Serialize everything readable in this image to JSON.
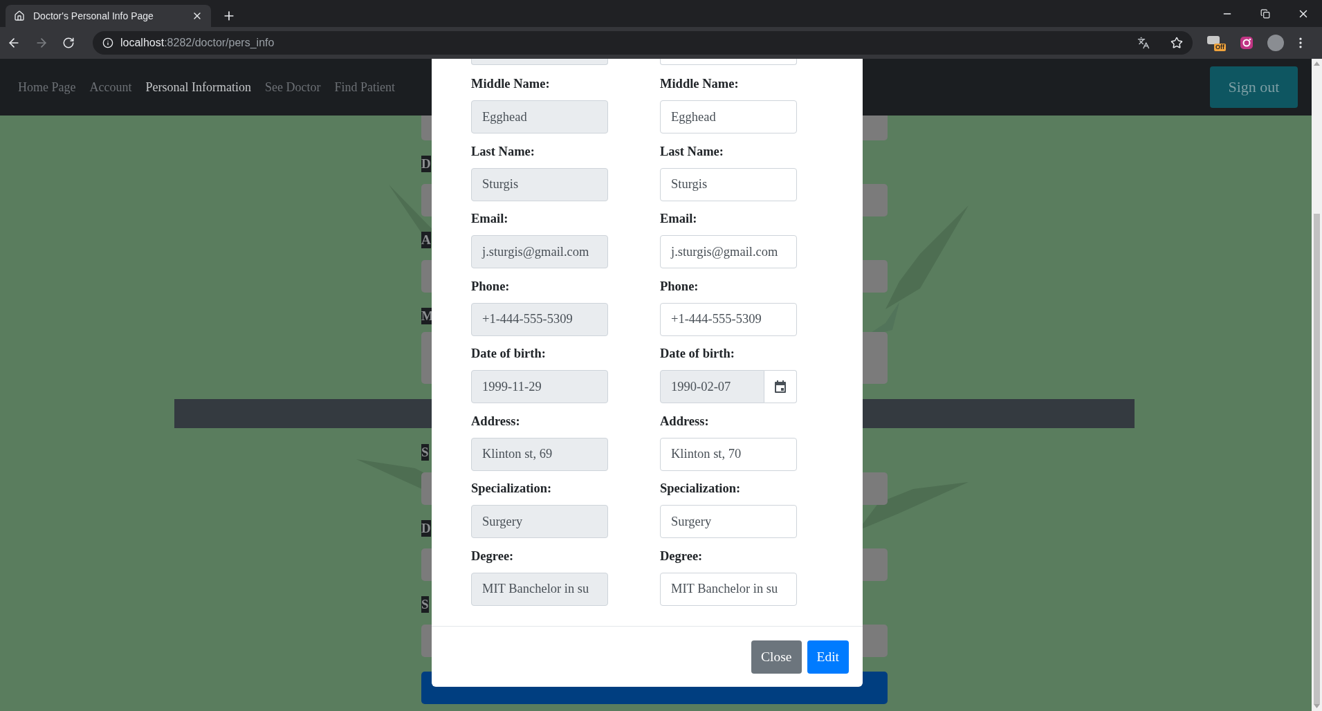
{
  "browser": {
    "tab": {
      "title": "Doctor's Personal Info Page"
    },
    "url": {
      "host": "localhost",
      "path": ":8282/doctor/pers_info"
    },
    "extension_badge": "Off"
  },
  "navbar": {
    "links": [
      {
        "label": "Home Page",
        "selected": false
      },
      {
        "label": "Account",
        "selected": false
      },
      {
        "label": "Personal Information",
        "selected": true
      },
      {
        "label": "See Doctor",
        "selected": false
      },
      {
        "label": "Find Patient",
        "selected": false
      }
    ],
    "sign_out": "Sign out"
  },
  "background_form": {
    "sections": [
      {
        "fields": [
          {
            "kind": "cut"
          },
          {
            "kind": "input",
            "label": "D"
          },
          {
            "kind": "input",
            "label": "A"
          },
          {
            "kind": "textarea",
            "label": "M"
          }
        ]
      },
      {
        "fields": [
          {
            "kind": "input",
            "label": "S"
          },
          {
            "kind": "input",
            "label": "D"
          },
          {
            "kind": "input",
            "label": "S"
          }
        ]
      }
    ]
  },
  "modal": {
    "columns": [
      {
        "fields": [
          {
            "kind": "cut",
            "disabled": true
          },
          {
            "kind": "text",
            "label": "Middle Name:",
            "value": "Egghead",
            "disabled": true
          },
          {
            "kind": "text",
            "label": "Last Name:",
            "value": "Sturgis",
            "disabled": true
          },
          {
            "kind": "text",
            "label": "Email:",
            "value": "j.sturgis@gmail.com",
            "disabled": true
          },
          {
            "kind": "text",
            "label": "Phone:",
            "value": "+1-444-555-5309",
            "disabled": true
          },
          {
            "kind": "text",
            "label": "Date of birth:",
            "value": "1999-11-29",
            "disabled": true
          },
          {
            "kind": "text",
            "label": "Address:",
            "value": "Klinton st, 69",
            "disabled": true
          },
          {
            "kind": "text",
            "label": "Specialization:",
            "value": "Surgery",
            "disabled": true
          },
          {
            "kind": "text",
            "label": "Degree:",
            "value": "MIT Banchelor in su",
            "disabled": true
          }
        ]
      },
      {
        "fields": [
          {
            "kind": "cut",
            "disabled": false
          },
          {
            "kind": "text",
            "label": "Middle Name:",
            "value": "Egghead",
            "disabled": false
          },
          {
            "kind": "text",
            "label": "Last Name:",
            "value": "Sturgis",
            "disabled": false
          },
          {
            "kind": "text",
            "label": "Email:",
            "value": "j.sturgis@gmail.com",
            "disabled": false
          },
          {
            "kind": "text",
            "label": "Phone:",
            "value": "+1-444-555-5309",
            "disabled": false
          },
          {
            "kind": "date",
            "label": "Date of birth:",
            "value": "1990-02-07",
            "disabled": true
          },
          {
            "kind": "text",
            "label": "Address:",
            "value": "Klinton st, 70",
            "disabled": false
          },
          {
            "kind": "text",
            "label": "Specialization:",
            "value": "Surgery",
            "disabled": false
          },
          {
            "kind": "text",
            "label": "Degree:",
            "value": "MIT Banchelor in su",
            "disabled": false
          }
        ]
      }
    ],
    "buttons": [
      {
        "label": "Close",
        "kind": "secondary"
      },
      {
        "label": "Edit",
        "kind": "primary"
      }
    ]
  }
}
